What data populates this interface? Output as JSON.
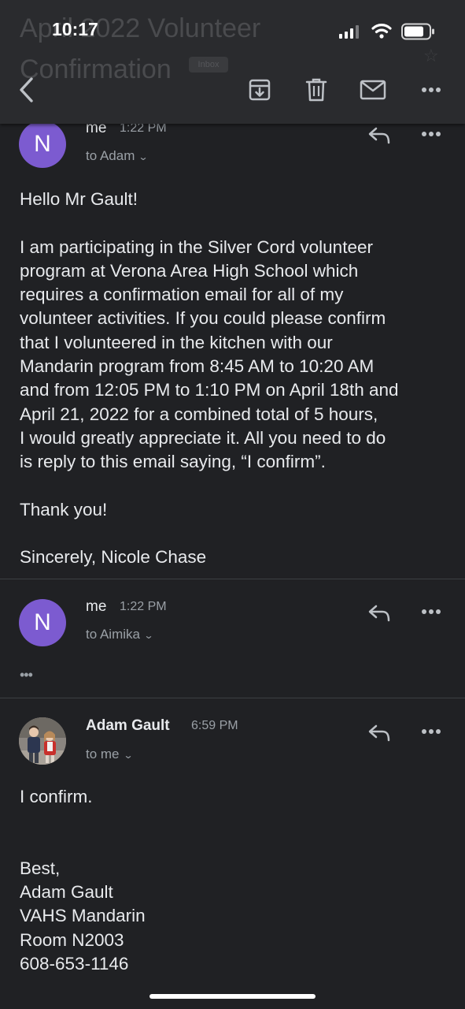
{
  "header": {
    "subject": "April 2022 Volunteer Confirmation",
    "label_badge": "Inbox"
  },
  "status_bar": {
    "time": "10:17"
  },
  "toolbar": {
    "back_icon": "chevron-left-icon",
    "archive_icon": "archive-icon",
    "delete_icon": "trash-icon",
    "unread_icon": "mail-icon",
    "more_icon": "more-horizontal-icon"
  },
  "messages": [
    {
      "avatar_letter": "N",
      "avatar_color": "#7c5bd0",
      "sender": "me",
      "time": "1:22 PM",
      "recipient": "to Adam",
      "body": [
        "Hello Mr Gault!",
        "",
        "I am participating in the Silver Cord volunteer",
        "program at Verona Area High School which",
        "requires a confirmation email for all of my",
        "volunteer activities. If you could please confirm",
        "that I volunteered in the kitchen with our",
        "Mandarin program from 8:45 AM to 10:20 AM",
        "and from 12:05 PM to 1:10 PM on April 18th and",
        "April 21, 2022 for a combined total of 5 hours,",
        "I would greatly appreciate it. All you need to do",
        "is reply to this email saying, “I confirm”.",
        "",
        "Thank you!",
        "",
        "Sincerely, Nicole Chase"
      ]
    },
    {
      "avatar_letter": "N",
      "avatar_color": "#7c5bd0",
      "sender": "me",
      "time": "1:22 PM",
      "recipient": "to Aimika",
      "collapsed_marker": "•••"
    },
    {
      "sender": "Adam Gault",
      "time": "6:59 PM",
      "recipient": "to me",
      "body": [
        "I confirm.",
        "",
        "",
        "Best,",
        "Adam Gault",
        "VAHS Mandarin",
        "Room N2003",
        "608-653-1146"
      ]
    }
  ],
  "colors": {
    "background": "#202124",
    "header_bg": "#2a2b2e",
    "avatar": "#7c5bd0",
    "text": "#e8eaed",
    "secondary_text": "#9aa0a6"
  }
}
